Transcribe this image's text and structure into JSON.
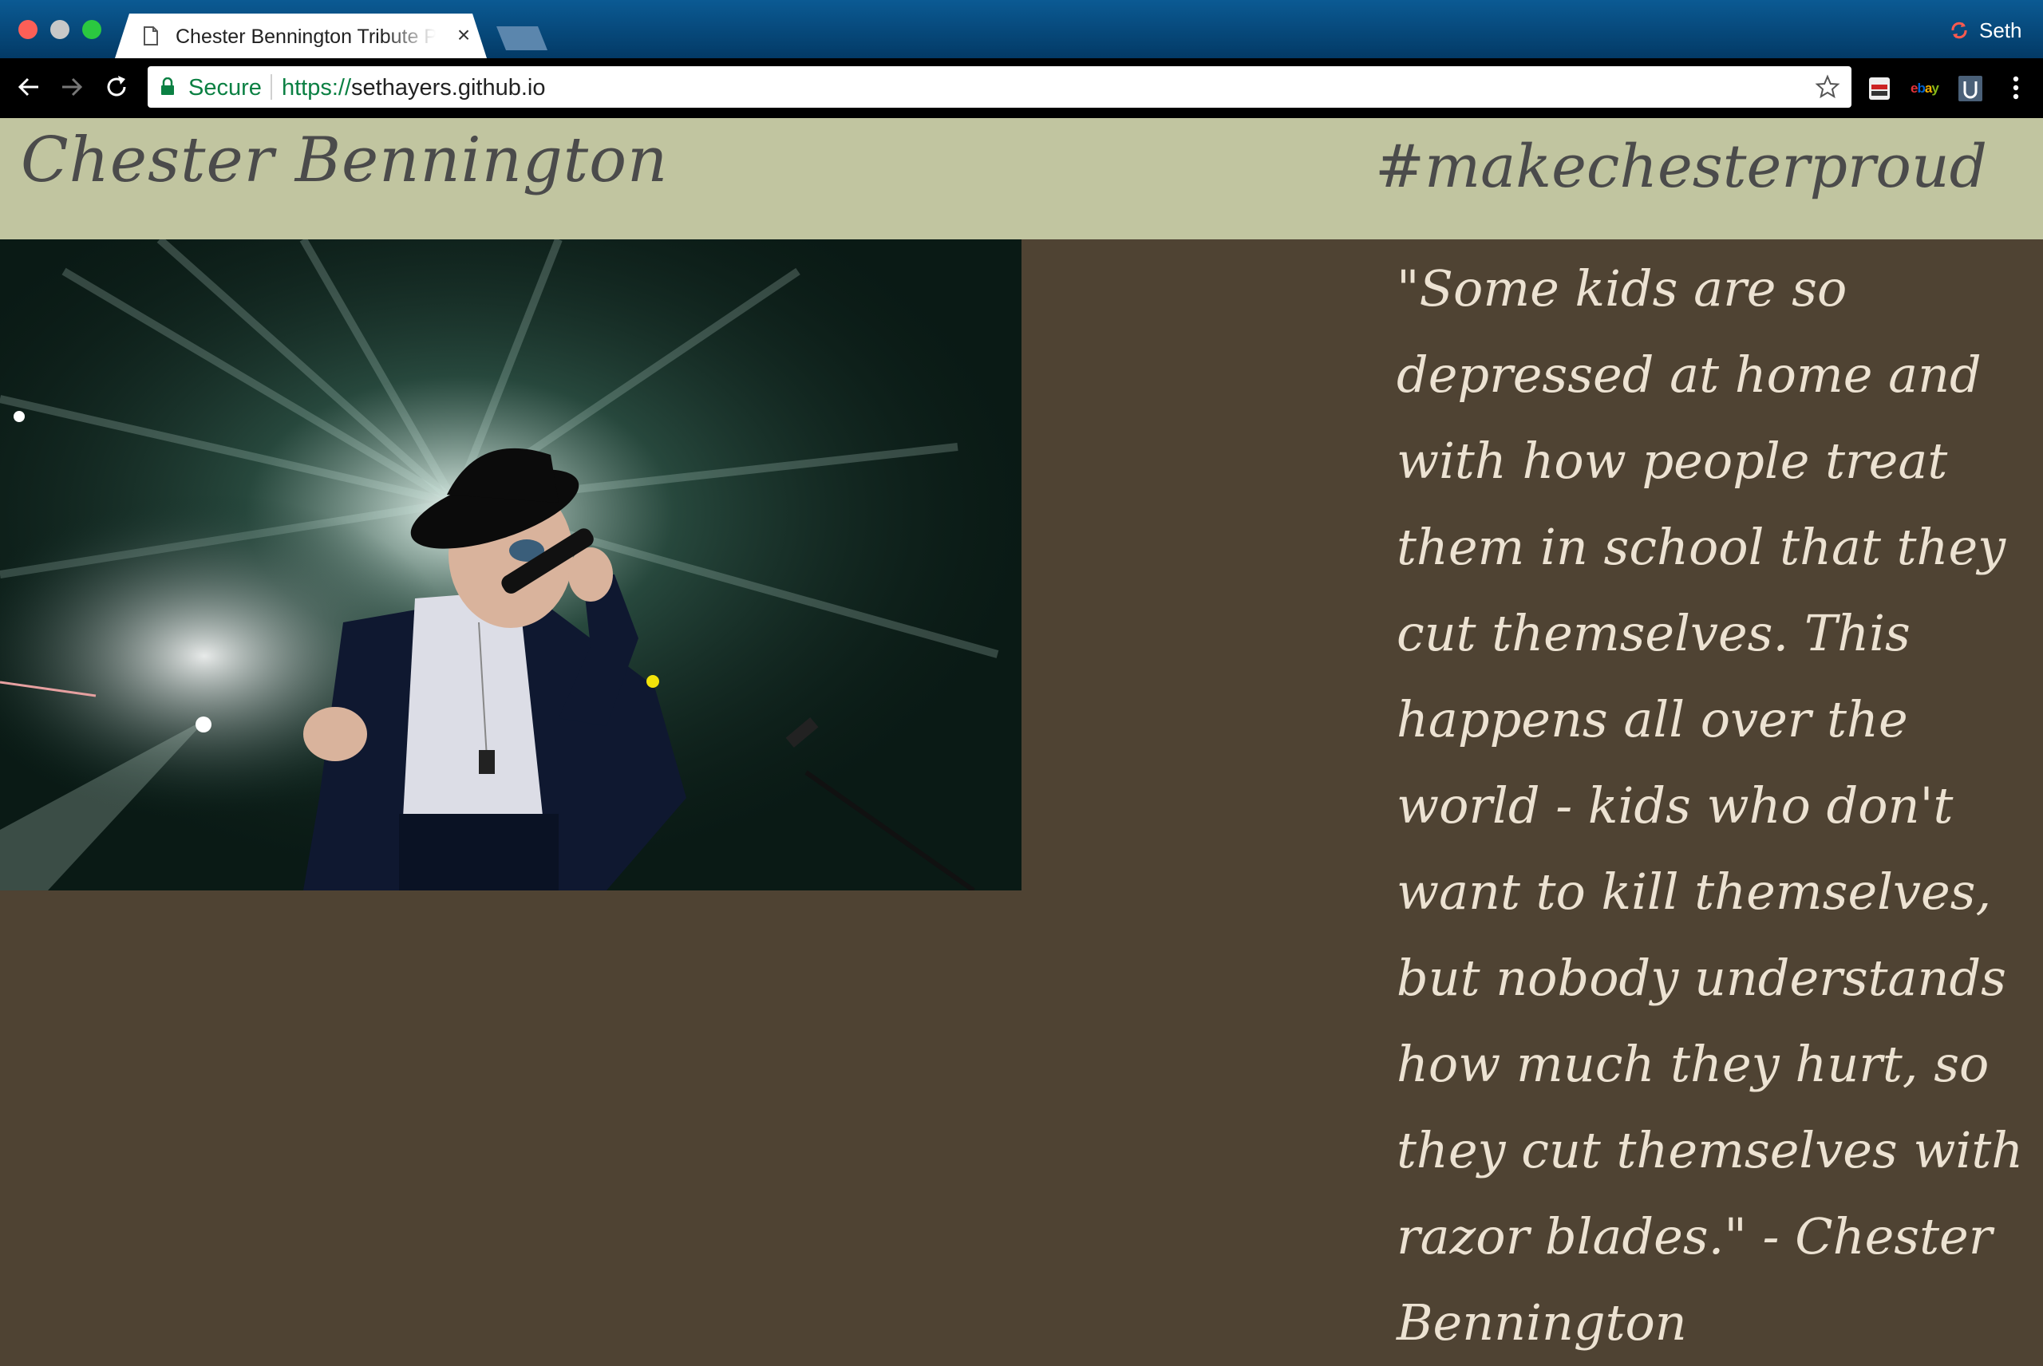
{
  "browser": {
    "tab_title": "Chester Bennington Tribute Page",
    "tab_close": "×",
    "profile_name": "Seth",
    "security_label": "Secure",
    "url_scheme": "https://",
    "url_host": "sethayers.github.io",
    "extensions": [
      "incognito-mask-extension",
      "ebay-extension",
      "u-extension"
    ],
    "ebay_label": "ebay"
  },
  "header": {
    "title": "Chester Bennington",
    "hashtag": "#makechesterproud"
  },
  "hero_image": {
    "description_icon": "concert-singer-photo"
  },
  "quote": {
    "text": "\"Some kids are so depressed at home and with how people treat them in school that they cut themselves. This happens all over the world - kids who don't want to kill themselves, but nobody understands how much they hurt, so they cut themselves with razor blades.\" - Chester Bennington"
  },
  "colors": {
    "header_bg": "#c1c5a0",
    "page_bg": "#4f4333",
    "quote_text": "#ece2d2",
    "title_text": "#4b4b4b",
    "secure_green": "#0b8043"
  }
}
